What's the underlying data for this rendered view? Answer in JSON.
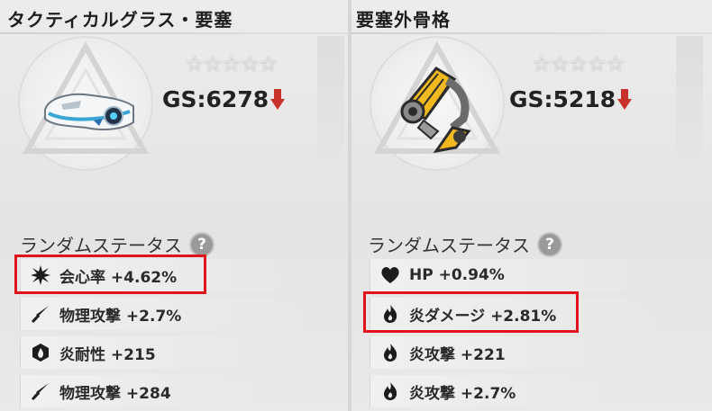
{
  "left": {
    "title": "タクティカルグラス・要塞",
    "stars": "☆☆☆☆☆",
    "gs": "GS:6278",
    "section_title": "ランダムステータス",
    "help": "?",
    "stats": [
      {
        "text": "会心率 +4.62%",
        "icon": "crit-star-icon",
        "highlighted": true
      },
      {
        "text": "物理攻撃 +2.7%",
        "icon": "sword-icon",
        "highlighted": false
      },
      {
        "text": "炎耐性 +215",
        "icon": "flame-shield-icon",
        "highlighted": false
      },
      {
        "text": "物理攻撃 +284",
        "icon": "sword-icon",
        "highlighted": false
      }
    ]
  },
  "right": {
    "title": "要塞外骨格",
    "stars": "☆☆☆☆☆",
    "gs": "GS:5218",
    "section_title": "ランダムステータス",
    "help": "?",
    "stats": [
      {
        "text": "HP +0.94%",
        "icon": "heart-icon",
        "highlighted": false
      },
      {
        "text": "炎ダメージ +2.81%",
        "icon": "flame-icon",
        "highlighted": true
      },
      {
        "text": "炎攻撃 +221",
        "icon": "flame-icon",
        "highlighted": false
      },
      {
        "text": "炎攻撃 +2.7%",
        "icon": "flame-icon",
        "highlighted": false
      }
    ]
  },
  "colors": {
    "highlight": "#e1141e",
    "gs_down_arrow": "#c9322a",
    "text": "#2a2a2a"
  }
}
